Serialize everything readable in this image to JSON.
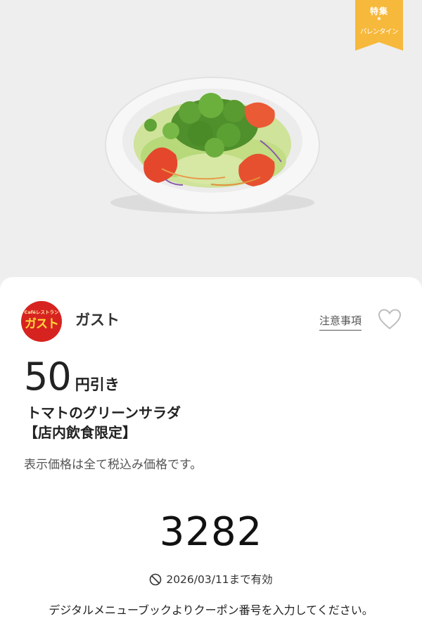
{
  "campaign": {
    "ribbon_top": "特集",
    "ribbon_sub": "バレンタイン",
    "color": "#f7b93b"
  },
  "store": {
    "logo_small": "Caféレストラン",
    "logo_main": "ガスト",
    "name": "ガスト",
    "logo_color": "#d7231f"
  },
  "actions": {
    "notes_label": "注意事項",
    "favorite_icon": "heart-icon"
  },
  "coupon": {
    "discount_value": "50",
    "discount_unit": "円引き",
    "item_name": "トマトのグリーンサラダ",
    "item_condition": "【店内飲食限定】",
    "tax_note": "表示価格は全て税込み価格です。",
    "code": "3282",
    "validity_icon": "no-entry-icon",
    "validity": "2026/03/11まで有効",
    "instruction": "デジタルメニューブックよりクーポン番号を入力してください。"
  }
}
